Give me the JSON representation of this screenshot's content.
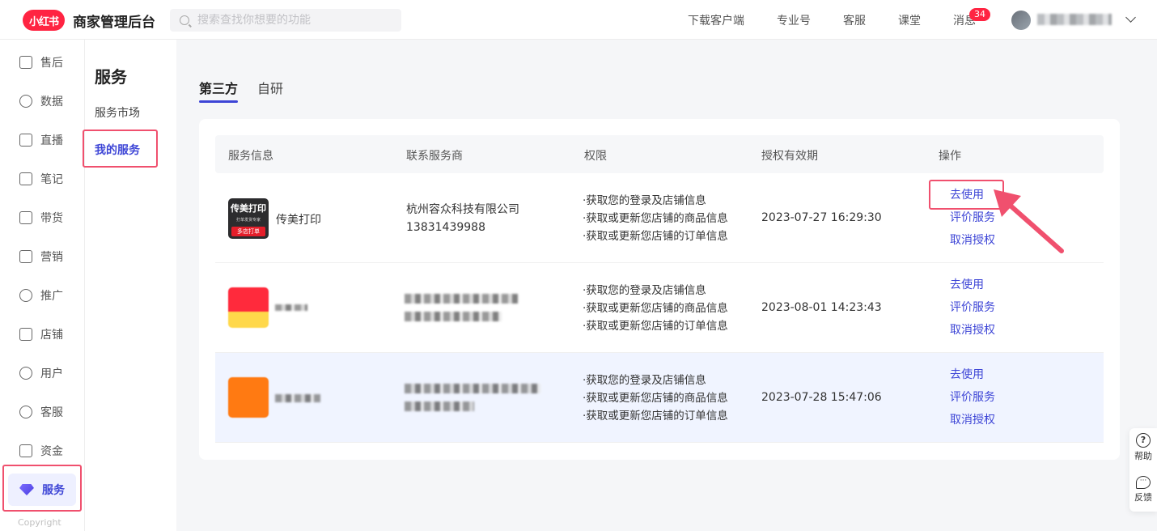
{
  "header": {
    "logo_text": "小红书",
    "title": "商家管理后台",
    "search_placeholder": "搜索查找你想要的功能",
    "nav": [
      "下载客户端",
      "专业号",
      "客服",
      "课堂",
      "消息"
    ],
    "message_badge": "34"
  },
  "sidebar": {
    "items": [
      {
        "label": "售后",
        "icon": "after-sale-icon"
      },
      {
        "label": "数据",
        "icon": "chart-icon"
      },
      {
        "label": "直播",
        "icon": "live-icon"
      },
      {
        "label": "笔记",
        "icon": "book-icon"
      },
      {
        "label": "带货",
        "icon": "bag-icon"
      },
      {
        "label": "营销",
        "icon": "megaphone-icon"
      },
      {
        "label": "推广",
        "icon": "promote-icon"
      },
      {
        "label": "店铺",
        "icon": "store-icon"
      },
      {
        "label": "用户",
        "icon": "users-icon"
      },
      {
        "label": "客服",
        "icon": "chat-icon"
      },
      {
        "label": "资金",
        "icon": "wallet-icon"
      },
      {
        "label": "服务",
        "icon": "diamond-icon"
      }
    ],
    "active": "服务",
    "copyright": "Copyright"
  },
  "subnav": {
    "title": "服务",
    "items": [
      "服务市场",
      "我的服务"
    ],
    "active": "我的服务"
  },
  "tabs": [
    "第三方",
    "自研"
  ],
  "table": {
    "headers": [
      "服务信息",
      "联系服务商",
      "权限",
      "授权有效期",
      "操作"
    ],
    "rows": [
      {
        "thumb_title": "传美打印",
        "thumb_sub": "打单发货专家",
        "thumb_tag": "多店打单",
        "name": "传美打印",
        "vendor_name": "杭州容众科技有限公司",
        "vendor_phone": "13831439988",
        "permissions": [
          "·获取您的登录及店铺信息",
          "·获取或更新您店铺的商品信息",
          "·获取或更新您店铺的订单信息"
        ],
        "expiry": "2023-07-27 16:29:30",
        "actions": [
          "去使用",
          "评价服务",
          "取消授权"
        ]
      },
      {
        "name": "",
        "vendor_name": "",
        "vendor_phone": "",
        "permissions": [
          "·获取您的登录及店铺信息",
          "·获取或更新您店铺的商品信息",
          "·获取或更新您店铺的订单信息"
        ],
        "expiry": "2023-08-01 14:23:43",
        "actions": [
          "去使用",
          "评价服务",
          "取消授权"
        ]
      },
      {
        "name": "",
        "vendor_name": "",
        "vendor_phone": "",
        "permissions": [
          "·获取您的登录及店铺信息",
          "·获取或更新您店铺的商品信息",
          "·获取或更新您店铺的订单信息"
        ],
        "expiry": "2023-07-28 15:47:06",
        "actions": [
          "去使用",
          "评价服务",
          "取消授权"
        ]
      }
    ]
  },
  "floating": {
    "help": "帮助",
    "feedback": "反馈"
  },
  "colors": {
    "brand": "#ff2442",
    "accent": "#3d45d6",
    "annotation": "#f0506e"
  }
}
